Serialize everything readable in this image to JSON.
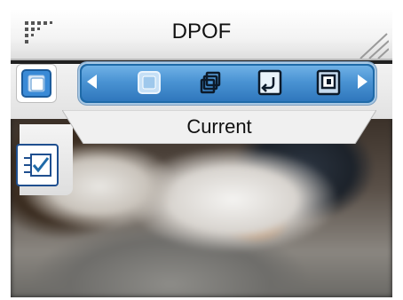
{
  "header": {
    "title": "DPOF",
    "mode_icon": "grid-dots-icon"
  },
  "selector": {
    "left_icon": "single-frame-icon",
    "options": [
      {
        "icon": "single-frame-icon",
        "selected": true
      },
      {
        "icon": "stacked-frames-icon",
        "selected": false
      },
      {
        "icon": "reset-return-icon",
        "selected": false
      },
      {
        "icon": "frame-index-icon",
        "selected": false
      }
    ],
    "caption": "Current"
  },
  "side": {
    "checklist_icon": "checklist-icon"
  },
  "colors": {
    "strip_blue": "#4a93d3",
    "strip_dark": "#1f6aa8",
    "selected_icon_blue": "#2f77bd",
    "check_border": "#1f4f8f"
  }
}
